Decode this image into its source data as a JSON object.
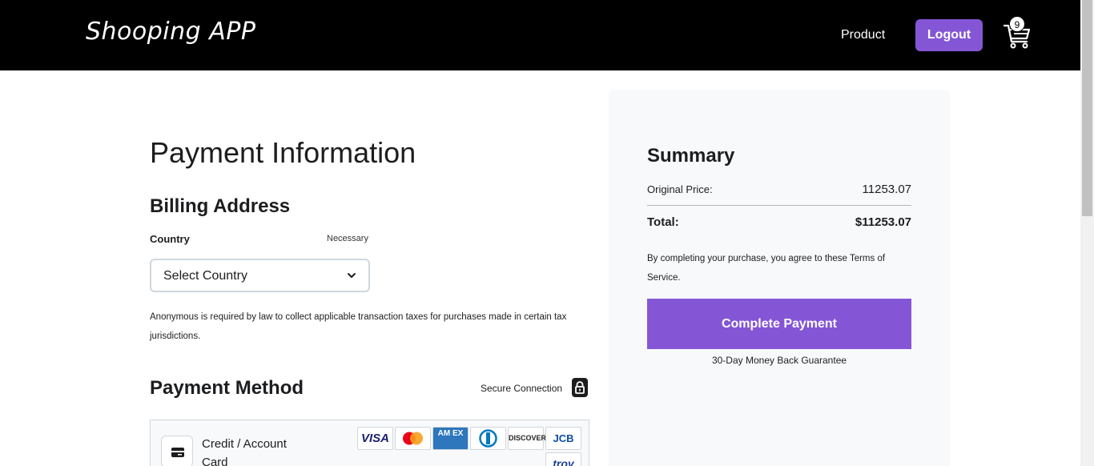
{
  "navbar": {
    "brand": "Shooping APP",
    "product_link": "Product",
    "logout_label": "Logout",
    "cart_count": "9"
  },
  "billing": {
    "page_title": "Payment Information",
    "section_title": "Billing Address",
    "country_label": "Country",
    "necessary_label": "Necessary",
    "country_selected": "Select Country",
    "tax_note": "Anonymous is required by law to collect applicable transaction taxes for purchases made in certain tax jurisdictions."
  },
  "payment_method": {
    "title": "Payment Method",
    "secure_text": "Secure Connection",
    "card_label": "Credit / Account Card",
    "logos": [
      {
        "name": "visa",
        "text": "VISA",
        "color": "#1a1f71"
      },
      {
        "name": "mastercard",
        "text": "",
        "color": "#eb001b"
      },
      {
        "name": "amex",
        "text": "AM EX",
        "color": "#2e77bc"
      },
      {
        "name": "diners",
        "text": "",
        "color": "#0079be"
      },
      {
        "name": "discover",
        "text": "DISCOVER",
        "color": "#231f20"
      },
      {
        "name": "jcb",
        "text": "JCB",
        "color": "#0b4ea2"
      },
      {
        "name": "troy",
        "text": "troy",
        "color": "#1c3f94"
      }
    ]
  },
  "summary": {
    "title": "Summary",
    "original_price_label": "Original Price:",
    "original_price_value": "11253.07",
    "total_label": "Total:",
    "total_value": "$11253.07",
    "terms": "By completing your purchase, you agree to these Terms of Service.",
    "complete_label": "Complete Payment",
    "guarantee": "30-Day Money Back Guarantee"
  },
  "colors": {
    "accent": "#8456d6",
    "navbar_bg": "#000000",
    "summary_bg": "#f7f9fa"
  }
}
